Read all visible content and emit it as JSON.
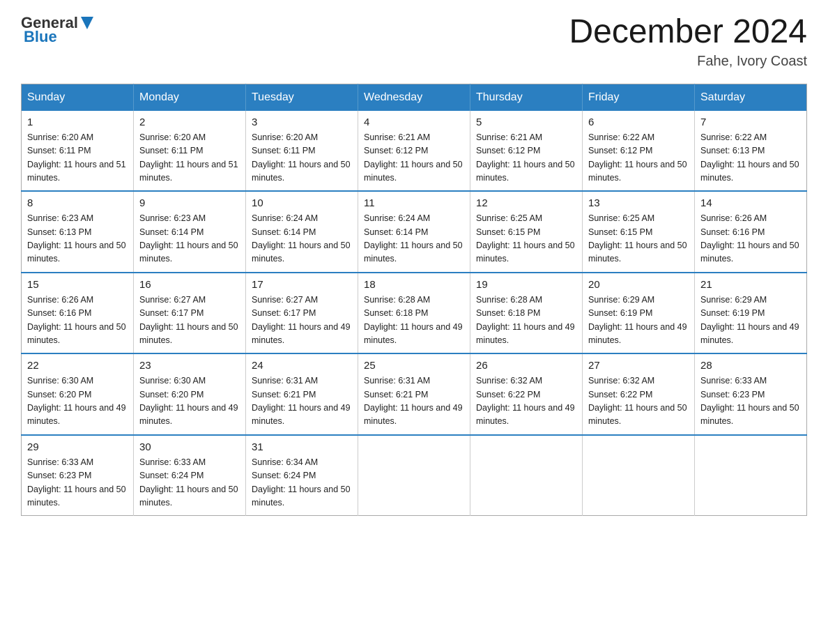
{
  "header": {
    "logo_general": "General",
    "logo_blue": "Blue",
    "month_title": "December 2024",
    "location": "Fahe, Ivory Coast"
  },
  "calendar": {
    "days_of_week": [
      "Sunday",
      "Monday",
      "Tuesday",
      "Wednesday",
      "Thursday",
      "Friday",
      "Saturday"
    ],
    "weeks": [
      [
        {
          "day": "1",
          "sunrise": "6:20 AM",
          "sunset": "6:11 PM",
          "daylight": "11 hours and 51 minutes."
        },
        {
          "day": "2",
          "sunrise": "6:20 AM",
          "sunset": "6:11 PM",
          "daylight": "11 hours and 51 minutes."
        },
        {
          "day": "3",
          "sunrise": "6:20 AM",
          "sunset": "6:11 PM",
          "daylight": "11 hours and 50 minutes."
        },
        {
          "day": "4",
          "sunrise": "6:21 AM",
          "sunset": "6:12 PM",
          "daylight": "11 hours and 50 minutes."
        },
        {
          "day": "5",
          "sunrise": "6:21 AM",
          "sunset": "6:12 PM",
          "daylight": "11 hours and 50 minutes."
        },
        {
          "day": "6",
          "sunrise": "6:22 AM",
          "sunset": "6:12 PM",
          "daylight": "11 hours and 50 minutes."
        },
        {
          "day": "7",
          "sunrise": "6:22 AM",
          "sunset": "6:13 PM",
          "daylight": "11 hours and 50 minutes."
        }
      ],
      [
        {
          "day": "8",
          "sunrise": "6:23 AM",
          "sunset": "6:13 PM",
          "daylight": "11 hours and 50 minutes."
        },
        {
          "day": "9",
          "sunrise": "6:23 AM",
          "sunset": "6:14 PM",
          "daylight": "11 hours and 50 minutes."
        },
        {
          "day": "10",
          "sunrise": "6:24 AM",
          "sunset": "6:14 PM",
          "daylight": "11 hours and 50 minutes."
        },
        {
          "day": "11",
          "sunrise": "6:24 AM",
          "sunset": "6:14 PM",
          "daylight": "11 hours and 50 minutes."
        },
        {
          "day": "12",
          "sunrise": "6:25 AM",
          "sunset": "6:15 PM",
          "daylight": "11 hours and 50 minutes."
        },
        {
          "day": "13",
          "sunrise": "6:25 AM",
          "sunset": "6:15 PM",
          "daylight": "11 hours and 50 minutes."
        },
        {
          "day": "14",
          "sunrise": "6:26 AM",
          "sunset": "6:16 PM",
          "daylight": "11 hours and 50 minutes."
        }
      ],
      [
        {
          "day": "15",
          "sunrise": "6:26 AM",
          "sunset": "6:16 PM",
          "daylight": "11 hours and 50 minutes."
        },
        {
          "day": "16",
          "sunrise": "6:27 AM",
          "sunset": "6:17 PM",
          "daylight": "11 hours and 50 minutes."
        },
        {
          "day": "17",
          "sunrise": "6:27 AM",
          "sunset": "6:17 PM",
          "daylight": "11 hours and 49 minutes."
        },
        {
          "day": "18",
          "sunrise": "6:28 AM",
          "sunset": "6:18 PM",
          "daylight": "11 hours and 49 minutes."
        },
        {
          "day": "19",
          "sunrise": "6:28 AM",
          "sunset": "6:18 PM",
          "daylight": "11 hours and 49 minutes."
        },
        {
          "day": "20",
          "sunrise": "6:29 AM",
          "sunset": "6:19 PM",
          "daylight": "11 hours and 49 minutes."
        },
        {
          "day": "21",
          "sunrise": "6:29 AM",
          "sunset": "6:19 PM",
          "daylight": "11 hours and 49 minutes."
        }
      ],
      [
        {
          "day": "22",
          "sunrise": "6:30 AM",
          "sunset": "6:20 PM",
          "daylight": "11 hours and 49 minutes."
        },
        {
          "day": "23",
          "sunrise": "6:30 AM",
          "sunset": "6:20 PM",
          "daylight": "11 hours and 49 minutes."
        },
        {
          "day": "24",
          "sunrise": "6:31 AM",
          "sunset": "6:21 PM",
          "daylight": "11 hours and 49 minutes."
        },
        {
          "day": "25",
          "sunrise": "6:31 AM",
          "sunset": "6:21 PM",
          "daylight": "11 hours and 49 minutes."
        },
        {
          "day": "26",
          "sunrise": "6:32 AM",
          "sunset": "6:22 PM",
          "daylight": "11 hours and 49 minutes."
        },
        {
          "day": "27",
          "sunrise": "6:32 AM",
          "sunset": "6:22 PM",
          "daylight": "11 hours and 50 minutes."
        },
        {
          "day": "28",
          "sunrise": "6:33 AM",
          "sunset": "6:23 PM",
          "daylight": "11 hours and 50 minutes."
        }
      ],
      [
        {
          "day": "29",
          "sunrise": "6:33 AM",
          "sunset": "6:23 PM",
          "daylight": "11 hours and 50 minutes."
        },
        {
          "day": "30",
          "sunrise": "6:33 AM",
          "sunset": "6:24 PM",
          "daylight": "11 hours and 50 minutes."
        },
        {
          "day": "31",
          "sunrise": "6:34 AM",
          "sunset": "6:24 PM",
          "daylight": "11 hours and 50 minutes."
        },
        null,
        null,
        null,
        null
      ]
    ]
  },
  "labels": {
    "sunrise_prefix": "Sunrise: ",
    "sunset_prefix": "Sunset: ",
    "daylight_prefix": "Daylight: "
  }
}
